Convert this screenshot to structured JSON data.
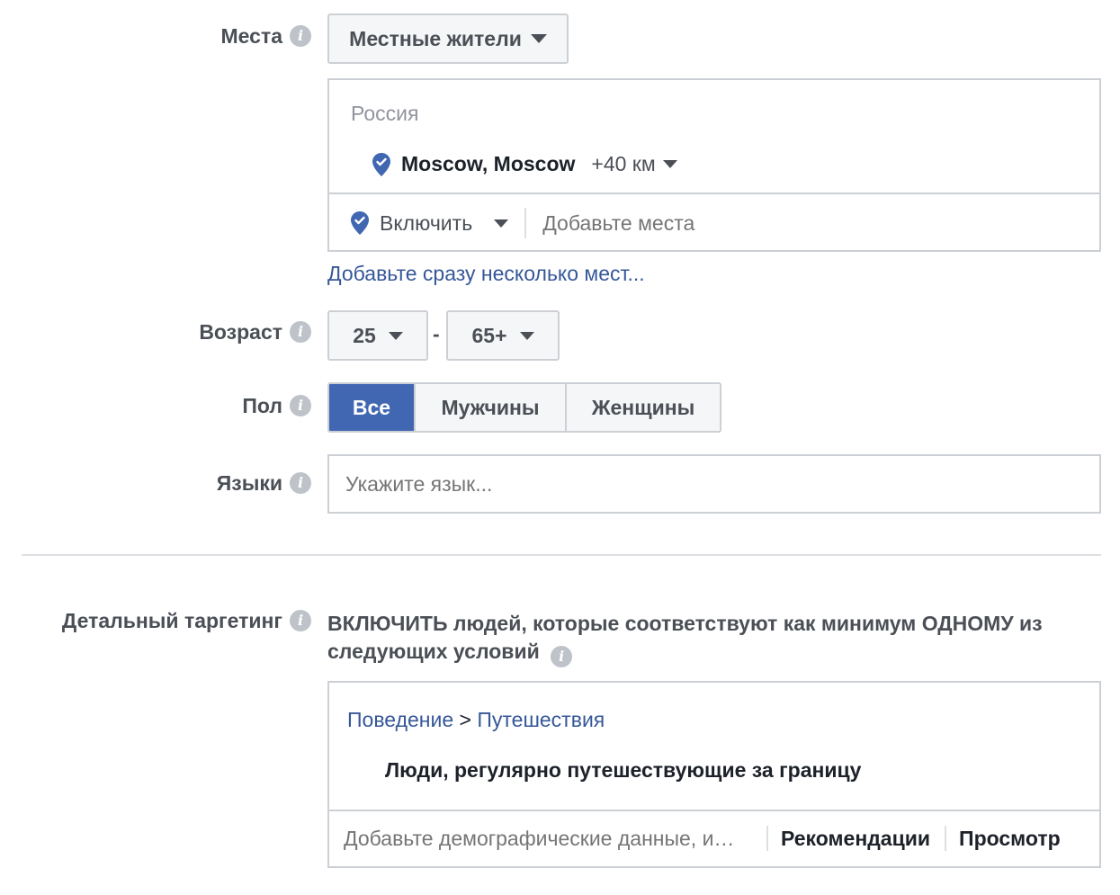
{
  "places": {
    "label": "Места",
    "dropdown_label": "Местные жители",
    "country": "Россия",
    "location_name": "Moscow, Moscow",
    "radius": "+40 км",
    "include_label": "Включить",
    "add_places_placeholder": "Добавьте места",
    "bulk_link": "Добавьте сразу несколько мест..."
  },
  "age": {
    "label": "Возраст",
    "min": "25",
    "separator": "-",
    "max": "65+"
  },
  "gender": {
    "label": "Пол",
    "options": [
      "Все",
      "Мужчины",
      "Женщины"
    ],
    "selected": "Все"
  },
  "languages": {
    "label": "Языки",
    "placeholder": "Укажите язык..."
  },
  "detailed_targeting": {
    "label": "Детальный таргетинг",
    "description": "ВКЛЮЧИТЬ людей, которые соответствуют как минимум ОДНОМУ из следующих условий",
    "breadcrumb_parent": "Поведение",
    "breadcrumb_sep": ">",
    "breadcrumb_child": "Путешествия",
    "item": "Люди, регулярно путешествующие за границу",
    "search_placeholder": "Добавьте демографические данные, и…",
    "recommendations_label": "Рекомендации",
    "browse_label": "Просмотр"
  },
  "colors": {
    "accent": "#4267b2",
    "link": "#365899",
    "pin": "#4267b2"
  }
}
